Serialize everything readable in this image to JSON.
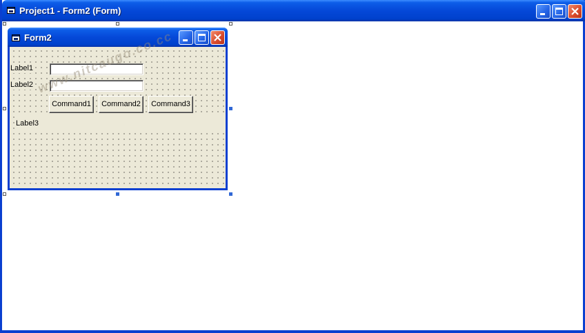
{
  "outer_window": {
    "title": "Project1 - Form2 (Form)",
    "title_icon": "form-icon",
    "buttons": [
      "minimize",
      "maximize",
      "close"
    ]
  },
  "form2": {
    "title": "Form2",
    "title_icon": "form-icon",
    "buttons": [
      "minimize",
      "maximize",
      "close"
    ],
    "labels": {
      "label1": "Label1",
      "label2": "Label2",
      "label3": "Label3"
    },
    "text1": {
      "value": ""
    },
    "text2": {
      "value": ""
    },
    "commands": {
      "command1": "Command1",
      "command2": "Command2",
      "command3": "Command3"
    }
  },
  "watermark": "www.nitcaugo.co.cc",
  "colors": {
    "titlebar_blue": "#0548d8",
    "form_face": "#ece9d8",
    "close_red": "#d8492a",
    "handle_blue": "#3168d5"
  }
}
